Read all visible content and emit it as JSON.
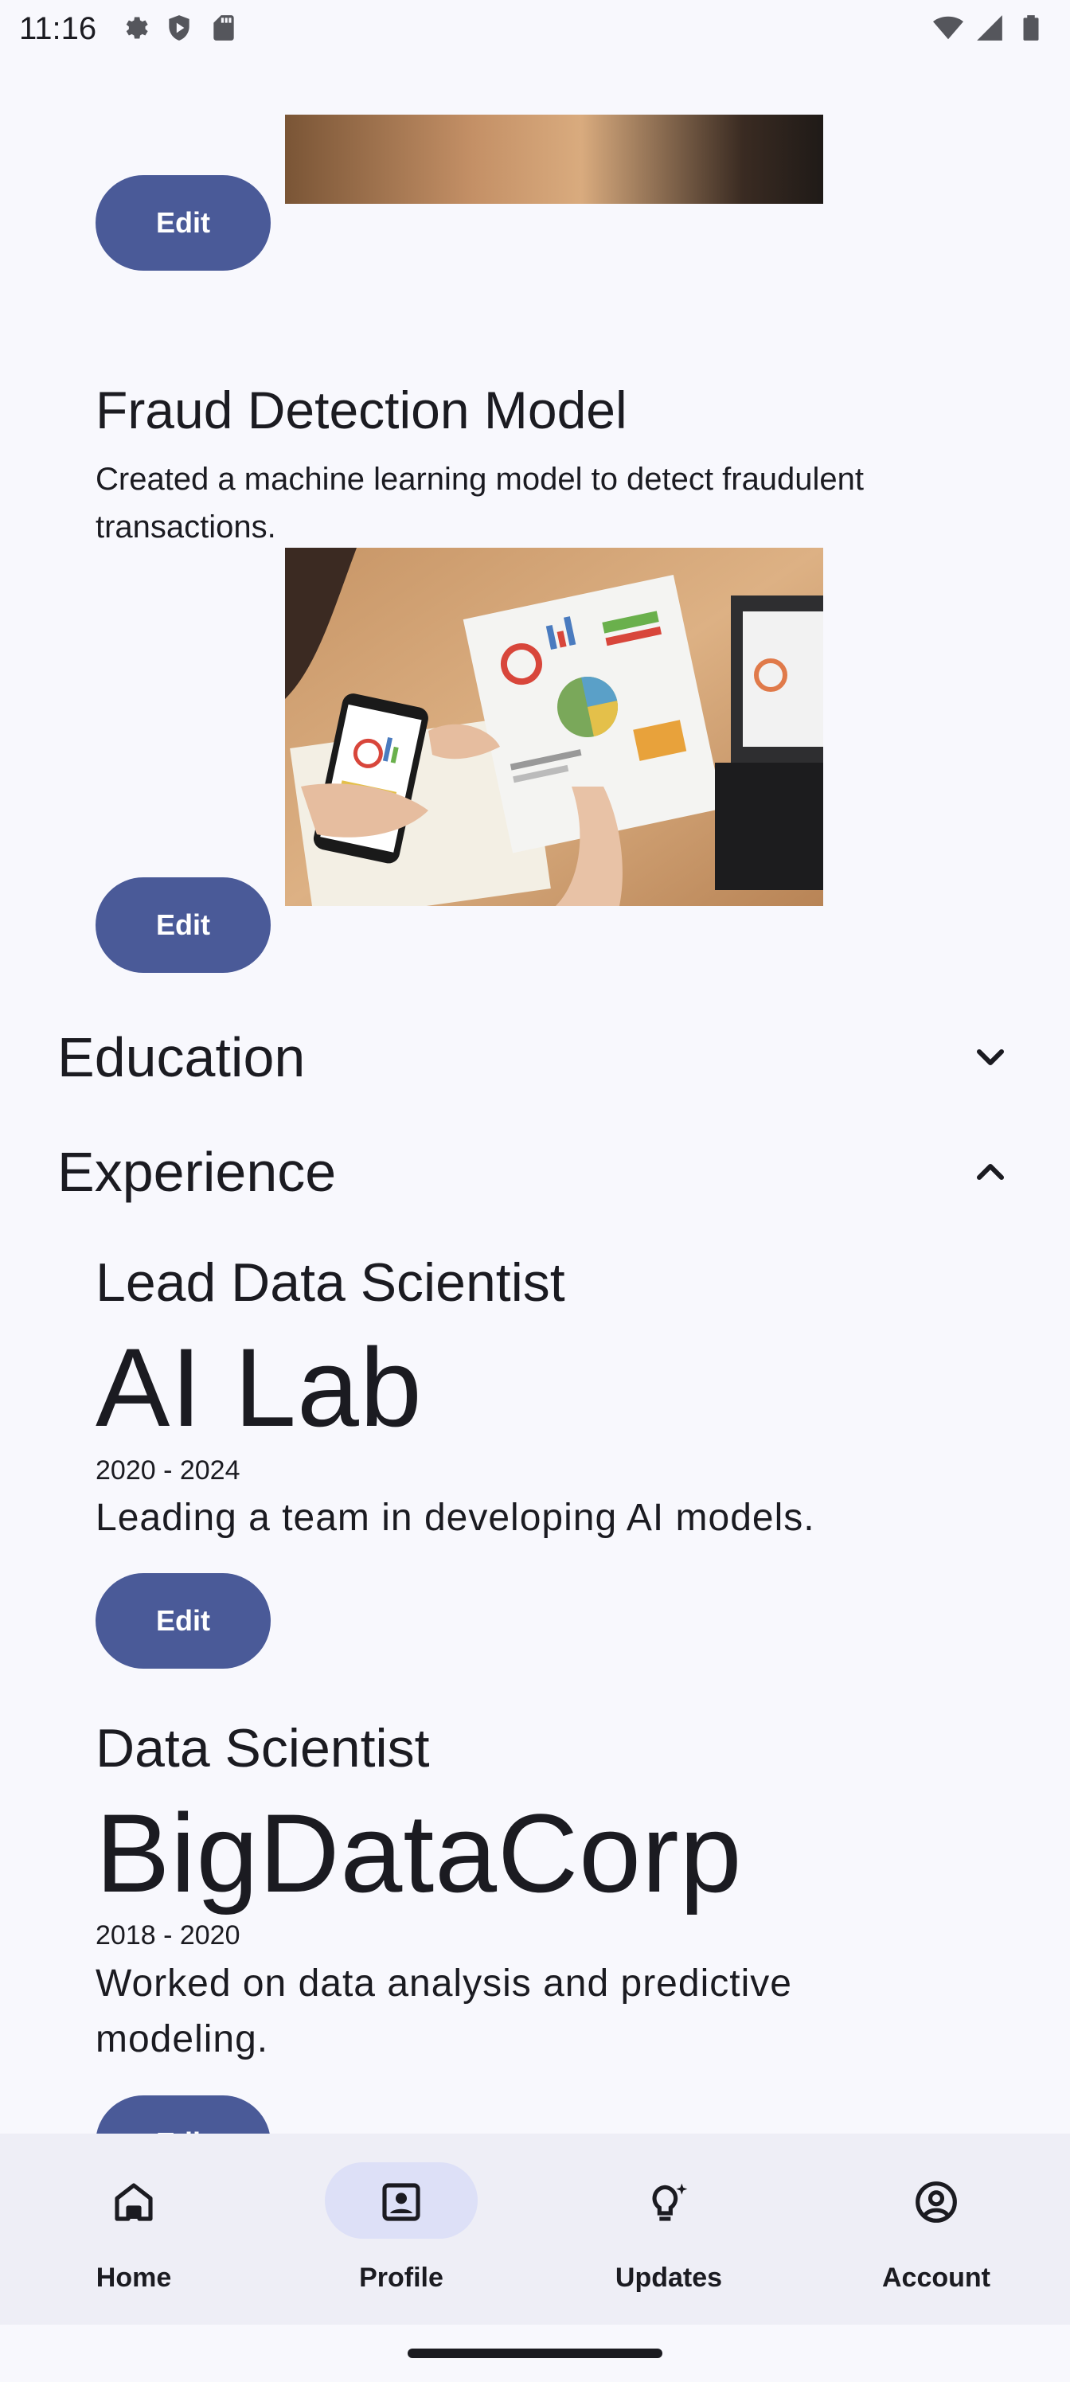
{
  "status_bar": {
    "time": "11:16",
    "left_icons": [
      "gear-icon",
      "shield-play-icon",
      "sd-card-icon"
    ],
    "right_icons": [
      "wifi-icon",
      "signal-icon",
      "battery-icon"
    ]
  },
  "projects": {
    "edit_label": "Edit",
    "fraud": {
      "title": "Fraud Detection Model",
      "description": "Created a machine learning model to detect fraudulent transactions."
    }
  },
  "sections": {
    "education": {
      "title": "Education",
      "expanded": false
    },
    "experience": {
      "title": "Experience",
      "expanded": true
    }
  },
  "experience": [
    {
      "title": "Lead Data Scientist",
      "company": "AI Lab",
      "years": "2020 - 2024",
      "description": "Leading a team in developing AI models.",
      "edit_label": "Edit"
    },
    {
      "title": "Data Scientist",
      "company": "BigDataCorp",
      "years": "2018 - 2020",
      "description": "Worked on data analysis and predictive modeling.",
      "edit_label": "Edit"
    }
  ],
  "bottom_nav": {
    "items": [
      {
        "label": "Home",
        "icon": "home-icon",
        "active": false
      },
      {
        "label": "Profile",
        "icon": "profile-badge-icon",
        "active": true
      },
      {
        "label": "Updates",
        "icon": "lightbulb-icon",
        "active": false
      },
      {
        "label": "Account",
        "icon": "account-circle-icon",
        "active": false
      }
    ]
  },
  "colors": {
    "background": "#f8f8fd",
    "button": "#4a5a98",
    "nav_background": "#eeeef6",
    "nav_active_pill": "#dde0f7"
  }
}
